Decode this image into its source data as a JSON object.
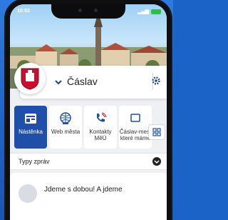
{
  "status_bar": {
    "time": "10:53"
  },
  "city": {
    "name": "Čáslav"
  },
  "tiles": [
    {
      "label": "Nástěnka",
      "active": true
    },
    {
      "label": "Web města"
    },
    {
      "label": "Kontakty MěÚ"
    },
    {
      "label": "Čáslav-mest které máme"
    }
  ],
  "section": {
    "title": "Typy zpráv"
  },
  "news": {
    "headline": "Jdeme s dobou! A jdeme"
  },
  "colors": {
    "accent": "#1f4fa8",
    "background": "#1c63c7"
  }
}
